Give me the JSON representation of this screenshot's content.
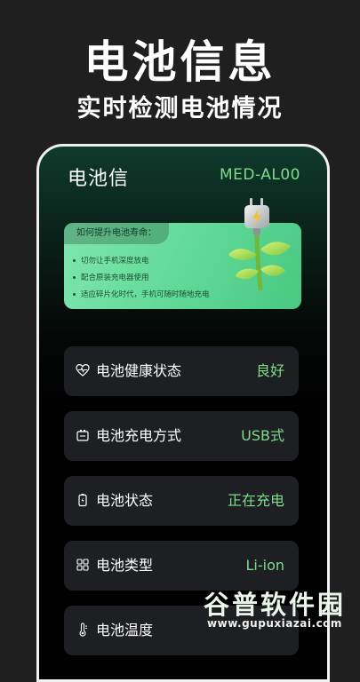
{
  "promo": {
    "title": "电池信息",
    "subtitle": "实时检测电池情况"
  },
  "header": {
    "app_title": "电池信",
    "device_model": "MED-AL00"
  },
  "tips": {
    "title": "如何提升电池寿命：",
    "items": [
      "切勿让手机深度放电",
      "配合原装充电器使用",
      "适应碎片化时代，手机可随时随地充电"
    ]
  },
  "rows": [
    {
      "label": "电池健康状态",
      "value": "良好",
      "icon": "heart-pulse-icon"
    },
    {
      "label": "电池充电方式",
      "value": "USB式",
      "icon": "battery-outline-icon"
    },
    {
      "label": "电池状态",
      "value": "正在充电",
      "icon": "battery-charging-icon"
    },
    {
      "label": "电池类型",
      "value": "Li-ion",
      "icon": "grid-icon"
    },
    {
      "label": "电池温度",
      "value": "",
      "icon": "thermometer-icon"
    }
  ],
  "watermark": {
    "title": "谷普软件园",
    "url": "www.gupuxiazai.com"
  },
  "colors": {
    "accent_green": "#7ddc8a",
    "card_bg": "#1e1f22",
    "tips_green": "#5fd896"
  }
}
